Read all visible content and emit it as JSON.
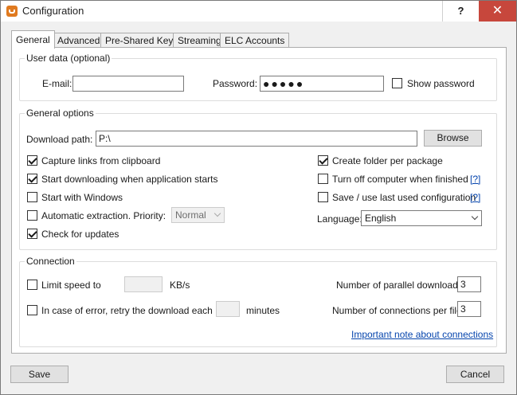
{
  "window": {
    "title": "Configuration",
    "help_label": "?",
    "close_label": "✕"
  },
  "tabs": [
    {
      "label": "General",
      "active": true
    },
    {
      "label": "Advanced",
      "active": false
    },
    {
      "label": "Pre-Shared Keys",
      "active": false
    },
    {
      "label": "Streaming",
      "active": false
    },
    {
      "label": "ELC Accounts",
      "active": false
    }
  ],
  "user_data": {
    "title": "User data (optional)",
    "email_label": "E-mail:",
    "email_value": "",
    "password_label": "Password:",
    "password_value": "●●●●●",
    "show_password_label": "Show password",
    "show_password_checked": false
  },
  "general_options": {
    "title": "General options",
    "download_path_label": "Download path:",
    "download_path_value": "P:\\",
    "browse_label": "Browse",
    "capture_links_label": "Capture links from clipboard",
    "capture_links_checked": true,
    "start_downloading_label": "Start downloading when application starts",
    "start_downloading_checked": true,
    "start_windows_label": "Start with Windows",
    "start_windows_checked": false,
    "auto_extract_label": "Automatic extraction. Priority:",
    "auto_extract_checked": false,
    "priority_value": "Normal",
    "check_updates_label": "Check for updates",
    "check_updates_checked": true,
    "create_folder_label": "Create folder per package",
    "create_folder_checked": true,
    "turn_off_label": "Turn off computer when finished",
    "turn_off_checked": false,
    "turn_off_help": "[?]",
    "save_config_label": "Save / use last used configuration",
    "save_config_checked": false,
    "save_config_help": "[?]",
    "language_label": "Language:",
    "language_value": "English"
  },
  "connection": {
    "title": "Connection",
    "limit_speed_label": "Limit speed to",
    "limit_speed_checked": false,
    "limit_speed_value": "",
    "speed_unit": "KB/s",
    "retry_label": "In case of error, retry the download each",
    "retry_checked": false,
    "retry_value": "",
    "retry_unit": "minutes",
    "parallel_label": "Number of parallel downloads:",
    "parallel_value": "3",
    "connections_label": "Number of connections per file:",
    "connections_value": "3",
    "note_link": "Important note about connections"
  },
  "footer": {
    "save_label": "Save",
    "cancel_label": "Cancel"
  }
}
